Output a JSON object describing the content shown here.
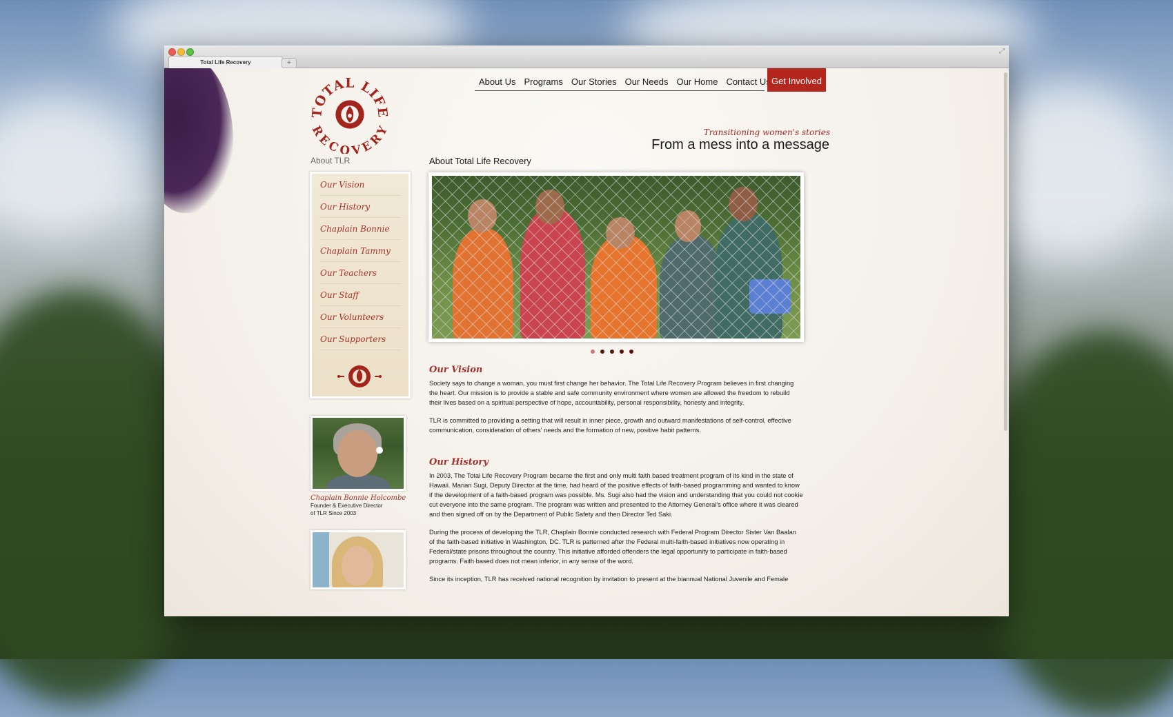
{
  "browser": {
    "tab_title": "Total Life Recovery",
    "new_tab_symbol": "+"
  },
  "brand": {
    "logo_text_top": "TOTAL LIFE",
    "logo_text_bottom": "RECOVERY",
    "accent_color": "#b3271f"
  },
  "nav": {
    "items": [
      "About Us",
      "Programs",
      "Our Stories",
      "Our Needs",
      "Our Home",
      "Contact Us"
    ],
    "cta": "Get Involved"
  },
  "hero_text": {
    "tagline": "Transitioning women's stories",
    "headline": "From a mess into a message"
  },
  "sidebar": {
    "title": "About TLR",
    "items": [
      "Our Vision",
      "Our History",
      "Chaplain Bonnie",
      "Chaplain Tammy",
      "Our Teachers",
      "Our Staff",
      "Our Volunteers",
      "Our Supporters"
    ]
  },
  "profile": {
    "name": "Chaplain Bonnie Holcombe",
    "role_line1": "Founder & Executive Director",
    "role_line2": "of TLR Since 2003"
  },
  "main": {
    "section_title": "About Total Life Recovery",
    "carousel": {
      "slide_count": 5,
      "active_index": 0
    },
    "vision_heading": "Our Vision",
    "vision_p1": "Society says to change a woman, you must first change her behavior. The Total Life Recovery Program believes in first changing the heart. Our mission is to provide a stable and safe community environment where women are allowed the freedom to rebuild their lives based on a spiritual perspective of hope, accountability, personal responsibility, honesty and integrity.",
    "vision_p2": "TLR is committed to providing a setting that will result in inner piece, growth and outward manifestations of self-control, effective communication, consideration of others' needs and the formation of new, positive habit patterns.",
    "history_heading": "Our History",
    "history_p1": "In 2003, The Total Life Recovery Program became the first and only multi faith based treatment program of its kind in the state of Hawaii. Marian Sugi, Deputy Director at the time, had heard of the positive effects of faith-based programming and wanted to know if the development of a faith-based program was possible. Ms. Sugi also had the vision and understanding that you could not cookie cut everyone into the same program. The program was written and presented to the Attorney General's office where it was cleared and then signed off on by the Department of Public Safety and then Director Ted Saki.",
    "history_p2": "During the process of developing the TLR, Chaplain Bonnie conducted research with Federal Program Director Sister Van Baalan of the faith-based initiative in Washington, DC. TLR is patterned after the Federal multi-faith-based initiatives now operating in Federal/state prisons throughout the country. This initiative afforded offenders the legal opportunity to participate in faith-based programs. Faith based does not mean inferior, in any sense of the word.",
    "history_p3": "Since its inception, TLR has received national recognition by invitation to present at the biannual National Juvenile and Female"
  }
}
